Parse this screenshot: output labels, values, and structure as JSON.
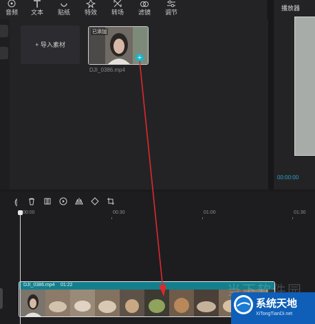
{
  "toolbar": {
    "items": [
      {
        "label": "音频",
        "icon": "audio-icon"
      },
      {
        "label": "文本",
        "icon": "text-icon"
      },
      {
        "label": "贴纸",
        "icon": "sticker-icon"
      },
      {
        "label": "特效",
        "icon": "effects-icon"
      },
      {
        "label": "转场",
        "icon": "transition-icon"
      },
      {
        "label": "滤镜",
        "icon": "filter-icon"
      },
      {
        "label": "调节",
        "icon": "adjust-icon"
      }
    ]
  },
  "media": {
    "import_label": "导入素材",
    "clip": {
      "name": "DJI_0386.mp4",
      "badge": "已添加"
    }
  },
  "player": {
    "title": "播放器",
    "time": "00:00:00"
  },
  "timeline": {
    "ruler": [
      "00:00",
      "00:30",
      "01:00",
      "01:30"
    ],
    "track": {
      "name": "DJI_0386.mp4",
      "duration": "01:22"
    }
  },
  "watermark": {
    "text": "当下软件园",
    "brand": "系统天地",
    "url": "XiTongTianDi.net"
  },
  "colors": {
    "accent": "#1fb4c4",
    "track": "#137f8c",
    "arrow": "#e0282c",
    "time": "#2fa3c9"
  }
}
